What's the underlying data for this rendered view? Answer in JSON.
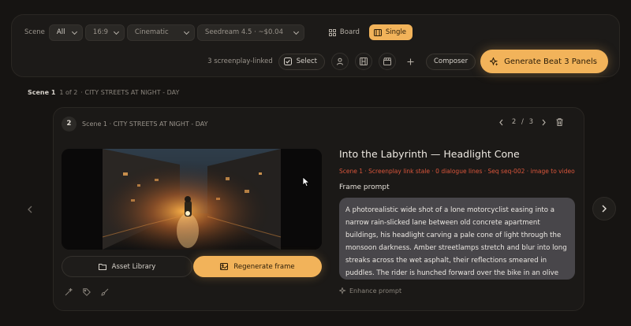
{
  "toolbar": {
    "scene_label": "Scene",
    "scene_filter": "All",
    "aspect_ratio": "16:9",
    "style": "Cinematic",
    "model": "Seedream 4.5 · ~$0.04",
    "view_board": "Board",
    "view_single": "Single",
    "linked_count": "3 screenplay-linked",
    "select_label": "Select",
    "composer_label": "Composer",
    "generate_label": "Generate Beat 3 Panels"
  },
  "scene_header": {
    "scene": "Scene 1",
    "position": "1 of 2",
    "heading": "· CITY STREETS AT NIGHT - DAY"
  },
  "beat": {
    "number": "2",
    "title": "Scene 1 · CITY STREETS AT NIGHT - DAY",
    "page_current": "2",
    "page_sep": "/",
    "page_total": "3",
    "shot_title": "Into the Labyrinth — Headlight Cone",
    "meta": "Scene 1 · Screenplay link stale · 0 dialogue lines · Seq seq-002 · image to video",
    "frame_prompt_label": "Frame prompt",
    "prompt": "A photorealistic wide shot of a lone motorcyclist easing into a narrow rain-slicked lane between old concrete apartment buildings, his headlight carving a pale cone of light through the monsoon darkness. Amber streetlamps stretch and blur into long streaks across the wet asphalt, their reflections smeared in puddles. The rider is hunched forward over the bike in an olive rain jacket as balconies drip overhead and laundry sways in the damp air.",
    "asset_library_label": "Asset Library",
    "regenerate_label": "Regenerate frame",
    "enhance_label": "Enhance prompt"
  },
  "colors": {
    "accent": "#f2b35a",
    "background": "#161412",
    "panel": "#1b1917",
    "warning": "#d9553b"
  }
}
